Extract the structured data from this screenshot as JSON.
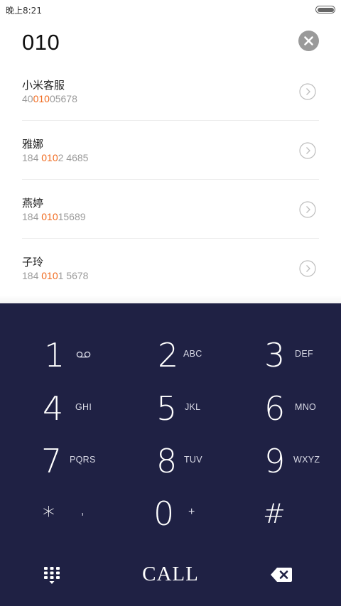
{
  "status_bar": {
    "time": "晚上8:21"
  },
  "dialer": {
    "number": "010"
  },
  "contacts": [
    {
      "name": "小米客服",
      "number_pre": "40",
      "number_match": "010",
      "number_post": "05678"
    },
    {
      "name": "雅娜",
      "number_pre": "184 ",
      "number_match": "010",
      "number_post": "2 4685"
    },
    {
      "name": "燕婷",
      "number_pre": "184 ",
      "number_match": "010",
      "number_post": "15689"
    },
    {
      "name": "子玲",
      "number_pre": "184 ",
      "number_match": "010",
      "number_post": "1 5678"
    }
  ],
  "keys": [
    {
      "digit": "1",
      "letters": ""
    },
    {
      "digit": "2",
      "letters": "ABC"
    },
    {
      "digit": "3",
      "letters": "DEF"
    },
    {
      "digit": "4",
      "letters": "GHI"
    },
    {
      "digit": "5",
      "letters": "JKL"
    },
    {
      "digit": "6",
      "letters": "MNO"
    },
    {
      "digit": "7",
      "letters": "PQRS"
    },
    {
      "digit": "8",
      "letters": "TUV"
    },
    {
      "digit": "9",
      "letters": "WXYZ"
    },
    {
      "digit": "*",
      "letters": ","
    },
    {
      "digit": "0",
      "letters": "+"
    },
    {
      "digit": "#",
      "letters": ""
    }
  ],
  "bottom_bar": {
    "call_label": "CALL"
  },
  "icons": {
    "voicemail": "voicemail-icon",
    "clear": "clear-icon",
    "detail": "chevron-right-circle-icon",
    "keypad_toggle": "dialpad-icon",
    "backspace": "backspace-icon"
  },
  "colors": {
    "keypad_background": "#1f2144",
    "match_highlight": "#f06a1e",
    "secondary_text": "#9b9b9b"
  }
}
